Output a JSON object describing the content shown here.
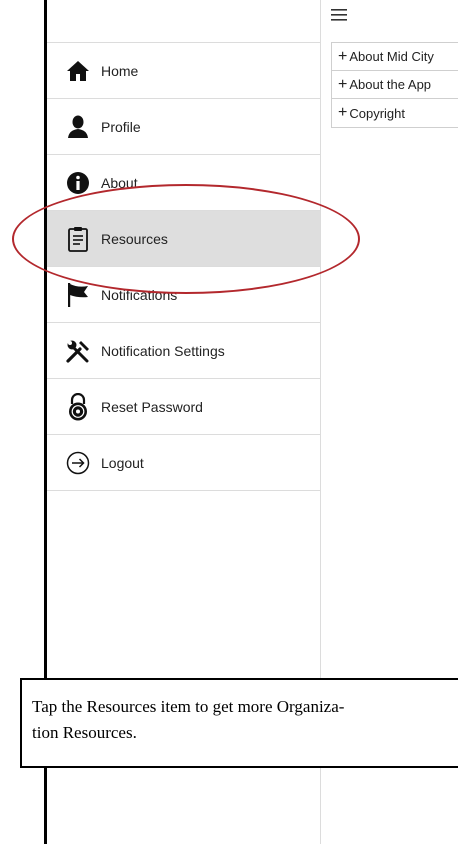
{
  "sidebar": {
    "items": [
      {
        "label": "Home",
        "icon": "home-icon"
      },
      {
        "label": "Profile",
        "icon": "user-icon"
      },
      {
        "label": "About",
        "icon": "info-icon"
      },
      {
        "label": "Resources",
        "icon": "clipboard-icon",
        "active": true
      },
      {
        "label": "Notifications",
        "icon": "flag-icon"
      },
      {
        "label": "Notification Settings",
        "icon": "tools-icon"
      },
      {
        "label": "Reset Password",
        "icon": "lock-icon"
      },
      {
        "label": "Logout",
        "icon": "logout-icon"
      }
    ]
  },
  "main": {
    "items": [
      {
        "label": "About Mid City"
      },
      {
        "label": "About the App"
      },
      {
        "label": "Copyright"
      }
    ]
  },
  "caption": {
    "line1": "Tap the Resources item to get more Organiza-",
    "line2": "tion Resources."
  },
  "colors": {
    "highlight": "#b3282d",
    "active_row": "#dedede"
  }
}
